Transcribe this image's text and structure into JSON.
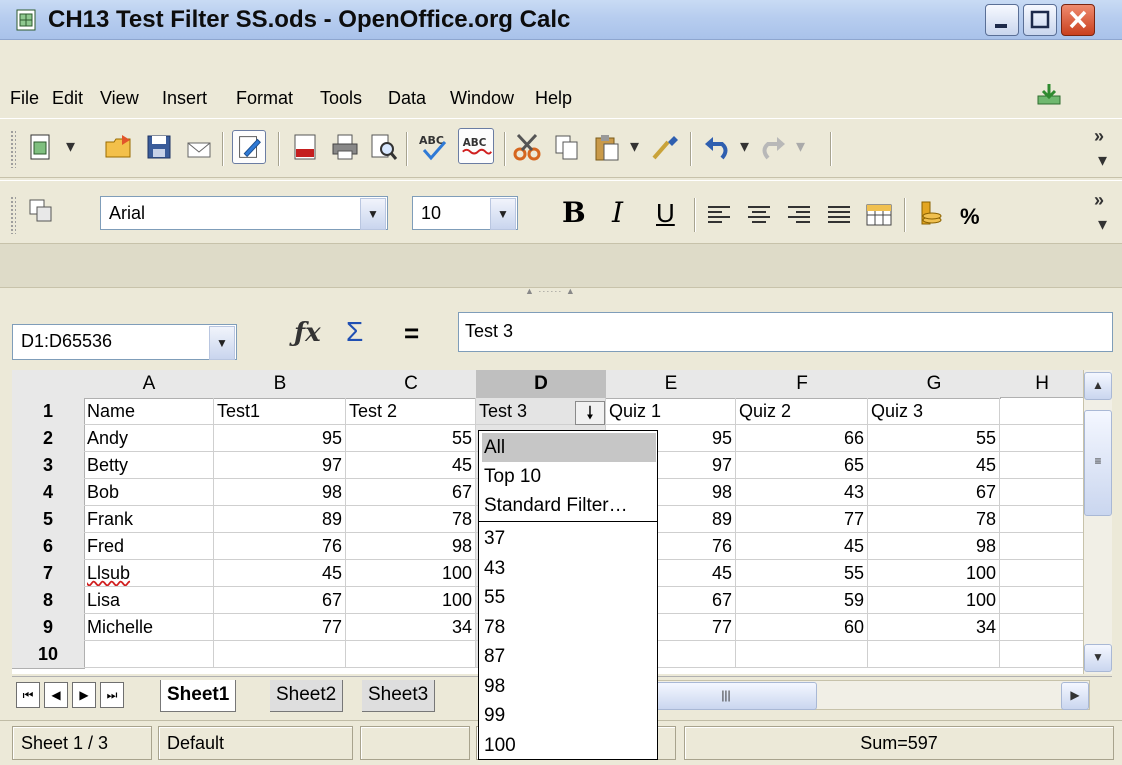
{
  "window": {
    "title": "CH13 Test Filter SS.ods - OpenOffice.org Calc",
    "controls": {
      "minimize": "–",
      "maximize": "□",
      "close": "✕"
    }
  },
  "menu": [
    "File",
    "Edit",
    "View",
    "Insert",
    "Format",
    "Tools",
    "Data",
    "Window",
    "Help"
  ],
  "toolbar_formatting": {
    "font_name": "Arial",
    "font_size": "10",
    "bold": "B",
    "italic": "I",
    "underline": "U",
    "percent": "%"
  },
  "formula_bar": {
    "name_box": "D1:D65536",
    "equals": "=",
    "content": "Test 3"
  },
  "sheet": {
    "columns": [
      "A",
      "B",
      "C",
      "D",
      "E",
      "F",
      "G",
      "H"
    ],
    "selected_column": "D",
    "rows": [
      "1",
      "2",
      "3",
      "4",
      "5",
      "6",
      "7",
      "8",
      "9",
      "10"
    ],
    "cells": [
      [
        "Name",
        "Test1",
        "Test 2",
        "Test 3",
        "Quiz 1",
        "Quiz 2",
        "Quiz 3",
        ""
      ],
      [
        "Andy",
        "95",
        "55",
        "",
        "95",
        "66",
        "55",
        ""
      ],
      [
        "Betty",
        "97",
        "45",
        "",
        "97",
        "65",
        "45",
        ""
      ],
      [
        "Bob",
        "98",
        "67",
        "",
        "98",
        "43",
        "67",
        ""
      ],
      [
        "Frank",
        "89",
        "78",
        "",
        "89",
        "77",
        "78",
        ""
      ],
      [
        "Fred",
        "76",
        "98",
        "",
        "76",
        "45",
        "98",
        ""
      ],
      [
        "Llsub",
        "45",
        "100",
        "",
        "45",
        "55",
        "100",
        ""
      ],
      [
        "Lisa",
        "67",
        "100",
        "",
        "67",
        "59",
        "100",
        ""
      ],
      [
        "Michelle",
        "77",
        "34",
        "",
        "77",
        "60",
        "34",
        ""
      ],
      [
        "",
        "",
        "",
        "",
        "",
        "",
        "",
        ""
      ]
    ]
  },
  "autofilter_dropdown": {
    "selected": "All",
    "items": [
      "All",
      "Top 10",
      "Standard Filter…",
      "37",
      "43",
      "55",
      "78",
      "87",
      "98",
      "99",
      "100"
    ]
  },
  "sheet_tabs": [
    "Sheet1",
    "Sheet2",
    "Sheet3"
  ],
  "active_sheet": "Sheet1",
  "status": {
    "sheet_position": "Sheet 1 / 3",
    "page_style": "Default",
    "sum": "Sum=597"
  },
  "colors": {
    "titlebar": "#b7cdef",
    "selected_column_header": "#bfbfbf",
    "dropdown_selected": "#c6c6c6",
    "close_button": "#c9401f"
  }
}
